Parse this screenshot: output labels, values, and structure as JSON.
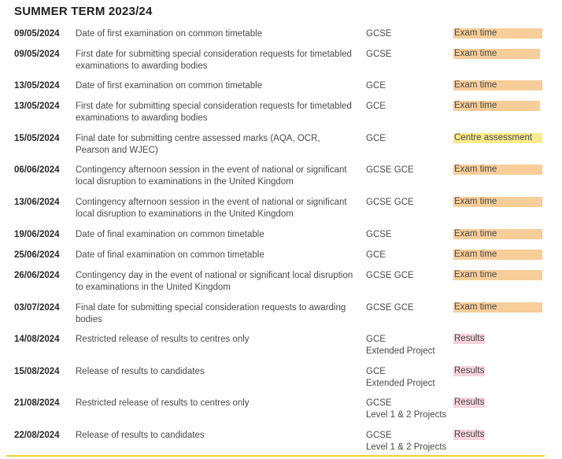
{
  "title": "SUMMER TERM 2023/24",
  "rows": [
    {
      "date": "09/05/2024",
      "description": "Date of first examination on common timetable",
      "qualification": "GCSE",
      "category": "Exam time"
    },
    {
      "date": "09/05/2024",
      "description": "First date for submitting special consideration requests for timetabled examinations to awarding bodies",
      "qualification": "GCSE",
      "category": "Exam time"
    },
    {
      "date": "13/05/2024",
      "description": "Date of first examination on common timetable",
      "qualification": "GCE",
      "category": "Exam time"
    },
    {
      "date": "13/05/2024",
      "description": "First date for submitting special consideration requests for timetabled examinations to awarding bodies",
      "qualification": "GCE",
      "category": "Exam time"
    },
    {
      "date": "15/05/2024",
      "description": "Final date for submitting centre assessed marks (AQA, OCR, Pearson and WJEC)",
      "qualification": "GCE",
      "category": "Centre assessment"
    },
    {
      "date": "06/06/2024",
      "description": "Contingency afternoon session in the event of national or significant local disruption to examinations in the United Kingdom",
      "qualification": "GCSE GCE",
      "category": "Exam time"
    },
    {
      "date": "13/06/2024",
      "description": "Contingency afternoon session in the event of national or significant local disruption to examinations in the United Kingdom",
      "qualification": "GCSE GCE",
      "category": "Exam time"
    },
    {
      "date": "19/06/2024",
      "description": "Date of final examination on common timetable",
      "qualification": "GCSE",
      "category": "Exam time"
    },
    {
      "date": "25/06/2024",
      "description": "Date of final examination on common timetable",
      "qualification": "GCE",
      "category": "Exam time"
    },
    {
      "date": "26/06/2024",
      "description": "Contingency day in the event of national or significant local disruption to examinations in the United Kingdom",
      "qualification": "GCSE GCE",
      "category": "Exam time"
    },
    {
      "date": "03/07/2024",
      "description": "Final date for submitting special consideration requests to awarding bodies",
      "qualification": "GCSE GCE",
      "category": "Exam time"
    },
    {
      "date": "14/08/2024",
      "description": "Restricted release of results to centres only",
      "qualification": "GCE\nExtended Project",
      "category": "Results"
    },
    {
      "date": "15/08/2024",
      "description": "Release of results to candidates",
      "qualification": "GCE\nExtended Project",
      "category": "Results"
    },
    {
      "date": "21/08/2024",
      "description": "Restricted release of results to centres only",
      "qualification": "GCSE\nLevel 1 & 2 Projects",
      "category": "Results"
    },
    {
      "date": "22/08/2024",
      "description": "Release of results to candidates",
      "qualification": "GCSE\nLevel 1 & 2 Projects",
      "category": "Results"
    }
  ],
  "colors": {
    "exam_time": "#f7cd99",
    "centre_assessment": "#fbea8e",
    "results": "#f6d3dc",
    "rule": "#f2d233"
  }
}
